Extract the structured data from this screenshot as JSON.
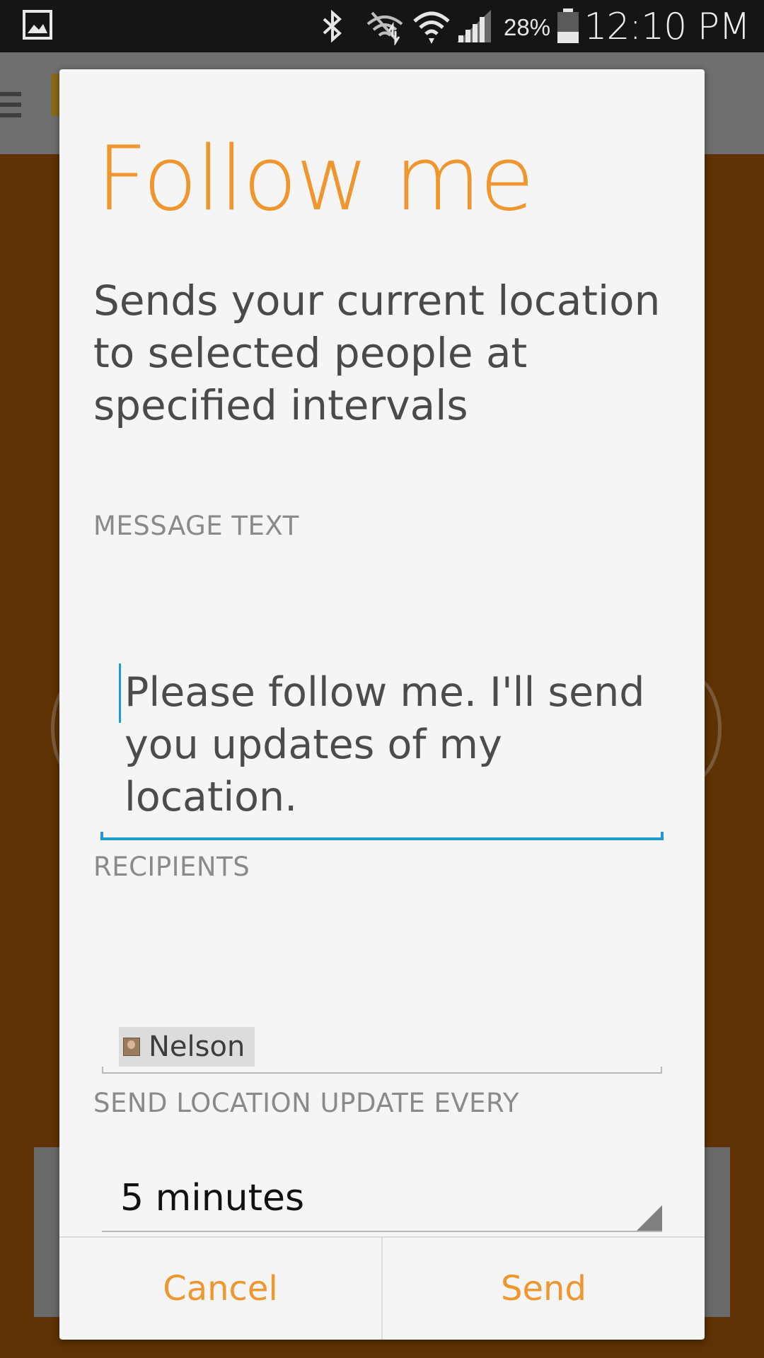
{
  "status_bar": {
    "battery_percent": "28%",
    "time": "12:10 PM",
    "icons": [
      "gallery-icon",
      "bluetooth-icon",
      "wifi-mute-icon",
      "wifi-icon",
      "signal-icon",
      "battery-icon"
    ]
  },
  "dialog": {
    "title": "Follow me",
    "description": "Sends your current location to selected people at specified intervals",
    "message_label": "MESSAGE TEXT",
    "message_value": "Please follow me. I'll send you updates of my location.",
    "recipients_label": "RECIPIENTS",
    "recipients": [
      {
        "name": "Nelson"
      }
    ],
    "interval_label": "SEND LOCATION UPDATE EVERY",
    "interval_value": "5 minutes",
    "cancel_label": "Cancel",
    "send_label": "Send"
  },
  "colors": {
    "accent": "#f0962e",
    "focus_underline": "#1e9bd2",
    "background_dim": "#5e3204"
  }
}
